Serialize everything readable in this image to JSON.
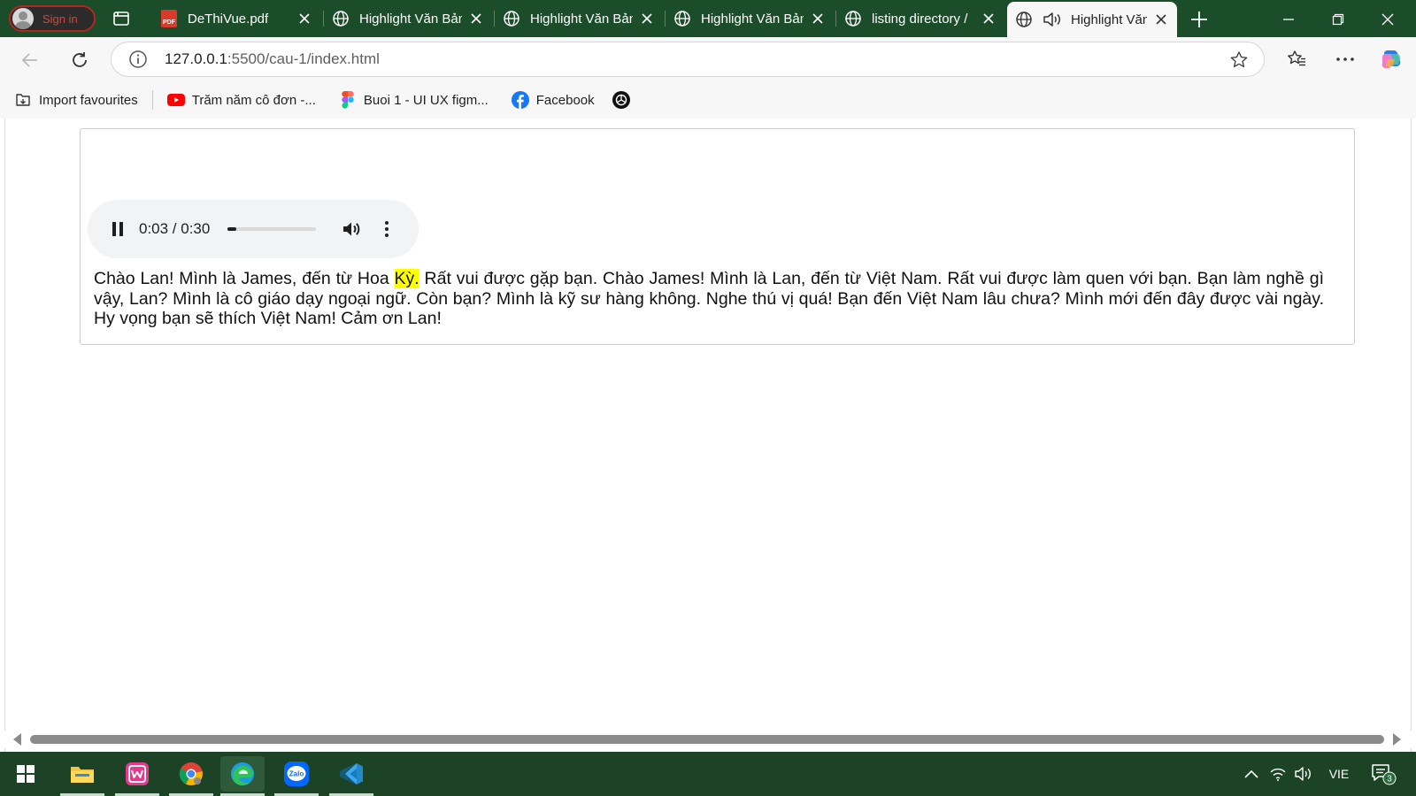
{
  "browser": {
    "profile_label": "Sign in",
    "tabs": [
      {
        "label": "DeThiVue.pdf",
        "icon": "pdf-icon"
      },
      {
        "label": "Highlight Văn Bản",
        "icon": "globe-icon"
      },
      {
        "label": "Highlight Văn Bản",
        "icon": "globe-icon"
      },
      {
        "label": "Highlight Văn Bản",
        "icon": "globe-icon"
      },
      {
        "label": "listing directory /",
        "icon": "globe-icon"
      },
      {
        "label": "Highlight Văn Bản",
        "icon": "globe-icon",
        "active": true,
        "playing_audio": true
      }
    ],
    "address": {
      "host": "127.0.0.1",
      "rest": ":5500/cau-1/index.html"
    },
    "bookmarks": [
      {
        "label": "Import favourites",
        "icon": "import-icon"
      },
      {
        "label": "Trăm năm cô đơn -...",
        "icon": "youtube-icon"
      },
      {
        "label": "Buoi 1 - UI UX figm...",
        "icon": "figma-icon"
      },
      {
        "label": "Facebook",
        "icon": "facebook-icon"
      },
      {
        "label": "",
        "icon": "openai-icon"
      }
    ]
  },
  "page": {
    "audio": {
      "time": "0:03 / 0:30",
      "progress": 0.1,
      "state": "playing"
    },
    "transcript": {
      "before": "Chào Lan! Mình là James, đến từ Hoa ",
      "highlight": "Kỳ.",
      "after": " Rất vui được gặp bạn. Chào James! Mình là Lan, đến từ Việt Nam. Rất vui được làm quen với bạn. Bạn làm nghề gì vậy, Lan? Mình là cô giáo dạy ngoại ngữ. Còn bạn? Mình là kỹ sư hàng không. Nghe thú vị quá! Bạn đến Việt Nam lâu chưa? Mình mới đến đây được vài ngày. Hy vọng bạn sẽ thích Việt Nam! Cảm ơn Lan!",
      "highlight_color": "#ffff00"
    }
  },
  "taskbar": {
    "apps": [
      "windows-start-icon",
      "file-explorer-icon",
      "wamp-icon",
      "chrome-icon",
      "edge-icon",
      "zalo-icon",
      "vscode-icon"
    ],
    "zalo_label": "Zalo",
    "language": "VIE",
    "notification_count": "3"
  },
  "colors": {
    "tabstrip": "#1c4d2b",
    "taskbar": "#1c4326",
    "highlight": "#ffff00"
  }
}
